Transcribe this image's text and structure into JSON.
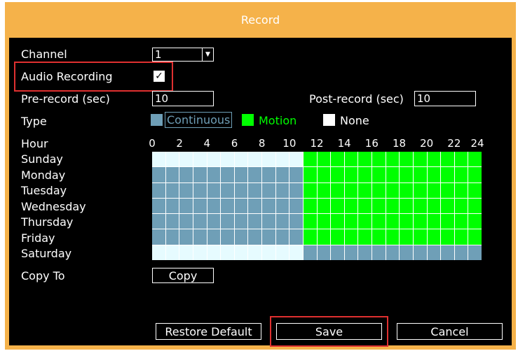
{
  "window": {
    "title": "Record"
  },
  "channel": {
    "label": "Channel",
    "value": "1"
  },
  "audio": {
    "label": "Audio Recording",
    "checked": true
  },
  "prerecord": {
    "label": "Pre-record (sec)",
    "value": "10"
  },
  "postrecord": {
    "label": "Post-record (sec)",
    "value": "10"
  },
  "type": {
    "label": "Type",
    "legend": [
      {
        "name": "Continuous",
        "color": "#6f9fb7"
      },
      {
        "name": "Motion",
        "color": "#00ff00"
      },
      {
        "name": "None",
        "color": "#ffffff"
      }
    ]
  },
  "schedule": {
    "hour_label": "Hour",
    "hour_ticks": [
      "0",
      "2",
      "4",
      "6",
      "8",
      "10",
      "12",
      "14",
      "16",
      "18",
      "20",
      "22",
      "24"
    ],
    "days": [
      "Sunday",
      "Monday",
      "Tuesday",
      "Wednesday",
      "Thursday",
      "Friday",
      "Saturday"
    ],
    "rows": [
      [
        "N",
        "N",
        "N",
        "N",
        "N",
        "N",
        "N",
        "N",
        "N",
        "N",
        "N",
        "M",
        "M",
        "M",
        "M",
        "M",
        "M",
        "M",
        "M",
        "M",
        "M",
        "M",
        "M",
        "M"
      ],
      [
        "C",
        "C",
        "C",
        "C",
        "C",
        "C",
        "C",
        "C",
        "C",
        "C",
        "C",
        "M",
        "M",
        "M",
        "M",
        "M",
        "M",
        "M",
        "M",
        "M",
        "M",
        "M",
        "M",
        "M"
      ],
      [
        "C",
        "C",
        "C",
        "C",
        "C",
        "C",
        "C",
        "C",
        "C",
        "C",
        "C",
        "M",
        "M",
        "M",
        "M",
        "M",
        "M",
        "M",
        "M",
        "M",
        "M",
        "M",
        "M",
        "M"
      ],
      [
        "C",
        "C",
        "C",
        "C",
        "C",
        "C",
        "C",
        "C",
        "C",
        "C",
        "C",
        "M",
        "M",
        "M",
        "M",
        "M",
        "M",
        "M",
        "M",
        "M",
        "M",
        "M",
        "M",
        "M"
      ],
      [
        "C",
        "C",
        "C",
        "C",
        "C",
        "C",
        "C",
        "C",
        "C",
        "C",
        "C",
        "M",
        "M",
        "M",
        "M",
        "M",
        "M",
        "M",
        "M",
        "M",
        "M",
        "M",
        "M",
        "M"
      ],
      [
        "C",
        "C",
        "C",
        "C",
        "C",
        "C",
        "C",
        "C",
        "C",
        "C",
        "C",
        "M",
        "M",
        "M",
        "M",
        "M",
        "M",
        "M",
        "M",
        "M",
        "M",
        "M",
        "M",
        "M"
      ],
      [
        "N",
        "N",
        "N",
        "N",
        "N",
        "N",
        "N",
        "N",
        "N",
        "N",
        "N",
        "C",
        "C",
        "C",
        "C",
        "C",
        "C",
        "C",
        "C",
        "C",
        "C",
        "C",
        "C",
        "C"
      ]
    ],
    "colors": {
      "C": "#6f9fb7",
      "M": "#00ff00",
      "N": "#e6fbff"
    }
  },
  "copy": {
    "label": "Copy To",
    "button": "Copy"
  },
  "footer": {
    "restore": "Restore Default",
    "save": "Save",
    "cancel": "Cancel"
  }
}
